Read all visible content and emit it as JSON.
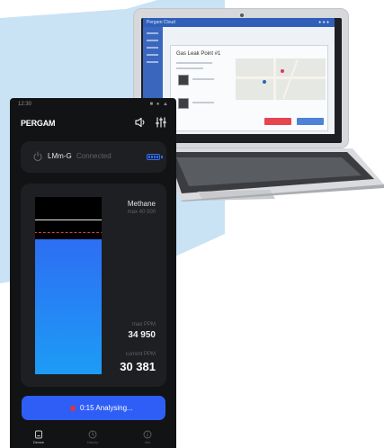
{
  "laptop": {
    "screen_header": "Pergam Cloud",
    "modal_title": "Gas Leak Point #1"
  },
  "phone": {
    "status": {
      "time": "12:30",
      "icons": "■ ● ▲"
    },
    "header": {
      "brand": "PERGAM",
      "icons": [
        "sound-icon",
        "equalizer-icon"
      ]
    },
    "device": {
      "name": "LMm-G",
      "status": "Connected",
      "battery_level": 1.0
    },
    "gauge": {
      "gas": "Methane",
      "max_range": "max 40 000",
      "max_ppm_label": "max PPM",
      "max_ppm_value": "34 950",
      "current_ppm_label": "current PPM",
      "current_ppm_value": "30 381",
      "scale_max": 40000,
      "current": 30381,
      "max_reading": 34950,
      "alarm_threshold": 32000
    },
    "action": {
      "label": "0:15  Analysing..."
    },
    "nav": [
      {
        "label": "Device",
        "icon": "device-icon",
        "active": true
      },
      {
        "label": "History",
        "icon": "clock-icon",
        "active": false
      },
      {
        "label": "Info",
        "icon": "info-icon",
        "active": false
      }
    ]
  },
  "colors": {
    "accent": "#2f5ef7",
    "alarm": "#e23a45",
    "background_shape": "#c9e3f4"
  }
}
